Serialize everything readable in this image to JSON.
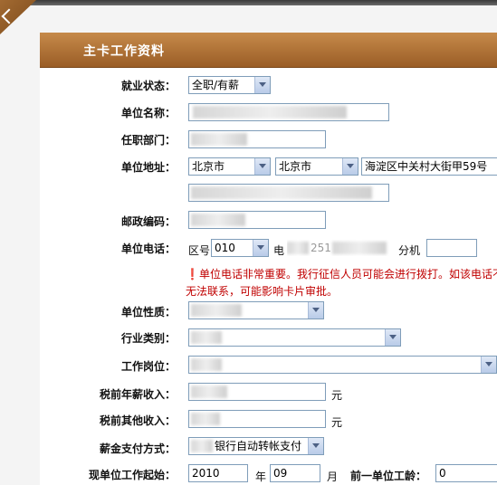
{
  "section": {
    "title": "主卡工作资料"
  },
  "labels": {
    "employment_status": "就业状态：",
    "company_name": "单位名称：",
    "department": "任职部门：",
    "company_address": "单位地址：",
    "postal_code": "邮政编码：",
    "company_phone": "单位电话：",
    "company_type": "单位性质：",
    "industry": "行业类别：",
    "position": "工作岗位：",
    "annual_salary": "税前年薪收入：",
    "other_income": "税前其他收入：",
    "salary_payment": "薪金支付方式：",
    "job_start": "现单位工作起始：",
    "prev_years": "前一单位工龄："
  },
  "fields": {
    "employment_status": "全职/有薪",
    "province": "北京市",
    "city": "北京市",
    "address_line": "海淀区中关村大街甲59号",
    "area_code_label": "区号",
    "area_code": "010",
    "phone_prefix": "电",
    "phone_partial": "251",
    "ext_label": "分机",
    "currency_unit_1": "元",
    "currency_unit_2": "元",
    "salary_payment_value": "银行自动转帐支付",
    "start_year": "2010",
    "year_unit": "年",
    "start_month": "09",
    "month_unit": "月",
    "prev_years_value": "0"
  },
  "warning": {
    "line1": "单位电话非常重要。我行征信人员可能会进行拨打。如该电话不",
    "line2": "无法联系，可能影响卡片审批。"
  },
  "colors": {
    "header": "#b07540",
    "warning": "#c00000",
    "border": "#7f9db9"
  }
}
